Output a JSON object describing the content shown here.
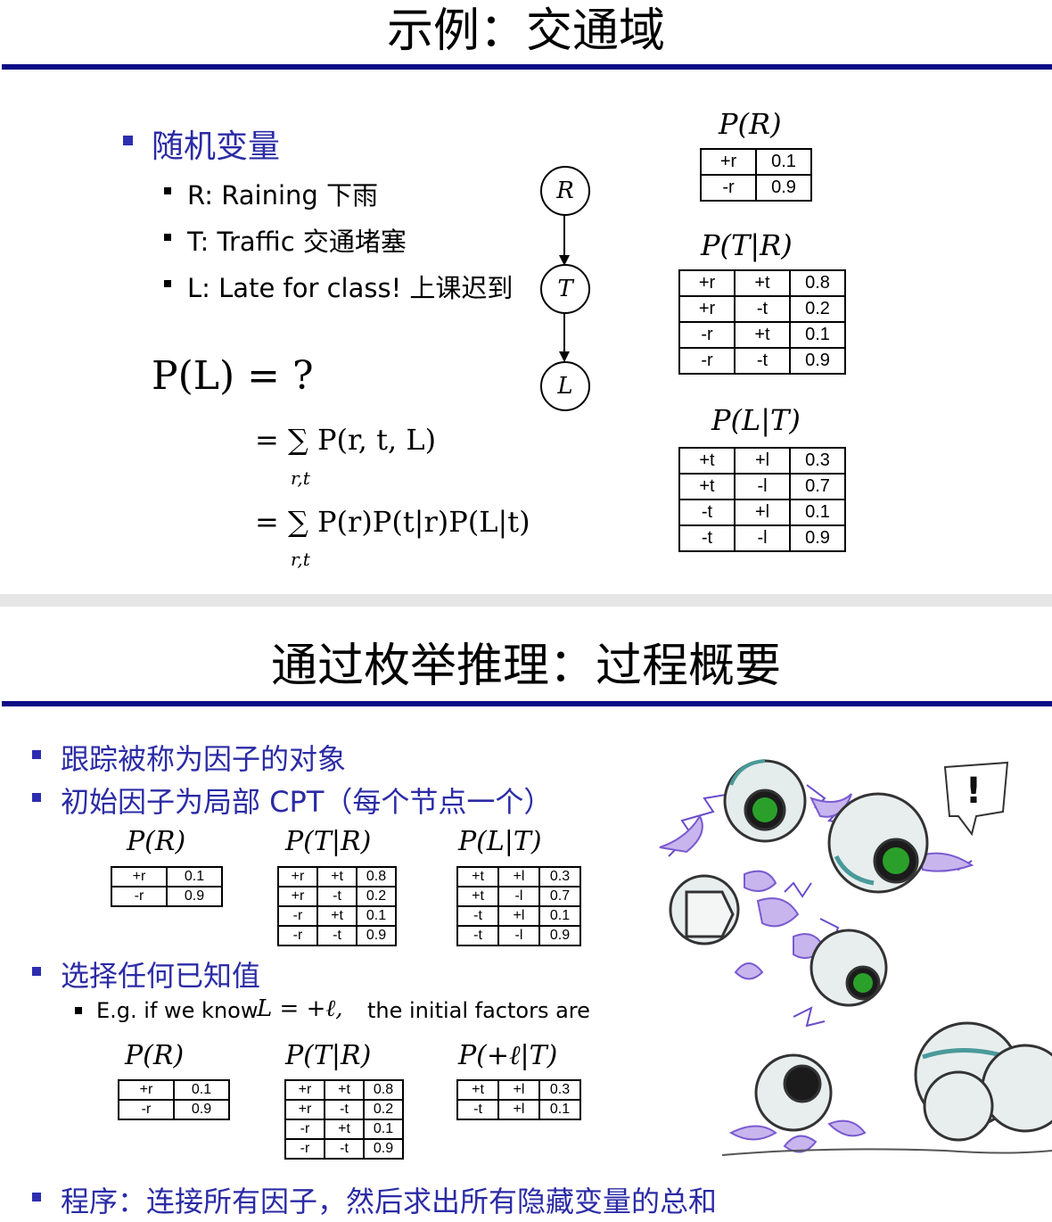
{
  "slide1": {
    "title": "示例：交通域",
    "heading": "随机变量",
    "items": [
      "R: Raining 下雨",
      "T: Traffic 交通堵塞",
      "L: Late for class! 上课迟到"
    ],
    "query": "P(L) = ?",
    "eq1": "= ∑ P(r, t, L)",
    "eq1_sub": "r,t",
    "eq2": "= ∑ P(r)P(t|r)P(L|t)",
    "eq2_sub": "r,t",
    "nodes": [
      "R",
      "T",
      "L"
    ],
    "cpt_r": {
      "title": "P(R)",
      "rows": [
        [
          "+r",
          "0.1"
        ],
        [
          "-r",
          "0.9"
        ]
      ]
    },
    "cpt_tr": {
      "title": "P(T|R)",
      "rows": [
        [
          "+r",
          "+t",
          "0.8"
        ],
        [
          "+r",
          "-t",
          "0.2"
        ],
        [
          "-r",
          "+t",
          "0.1"
        ],
        [
          "-r",
          "-t",
          "0.9"
        ]
      ]
    },
    "cpt_lt": {
      "title": "P(L|T)",
      "rows": [
        [
          "+t",
          "+l",
          "0.3"
        ],
        [
          "+t",
          "-l",
          "0.7"
        ],
        [
          "-t",
          "+l",
          "0.1"
        ],
        [
          "-t",
          "-l",
          "0.9"
        ]
      ]
    }
  },
  "slide2": {
    "title": "通过枚举推理：过程概要",
    "bullets": [
      "跟踪被称为因子的对象",
      "初始因子为局部 CPT（每个节点一个）",
      "选择任何已知值",
      "程序：连接所有因子，然后求出所有隐藏变量的总和"
    ],
    "eg_prefix": "E.g. if we know",
    "eg_math": "L = +ℓ,",
    "eg_suffix": "the initial factors are",
    "init_r": {
      "title": "P(R)",
      "rows": [
        [
          "+r",
          "0.1"
        ],
        [
          "-r",
          "0.9"
        ]
      ]
    },
    "init_tr": {
      "title": "P(T|R)",
      "rows": [
        [
          "+r",
          "+t",
          "0.8"
        ],
        [
          "+r",
          "-t",
          "0.2"
        ],
        [
          "-r",
          "+t",
          "0.1"
        ],
        [
          "-r",
          "-t",
          "0.9"
        ]
      ]
    },
    "init_lt": {
      "title": "P(L|T)",
      "rows": [
        [
          "+t",
          "+l",
          "0.3"
        ],
        [
          "+t",
          "-l",
          "0.7"
        ],
        [
          "-t",
          "+l",
          "0.1"
        ],
        [
          "-t",
          "-l",
          "0.9"
        ]
      ]
    },
    "sel_r": {
      "title": "P(R)",
      "rows": [
        [
          "+r",
          "0.1"
        ],
        [
          "-r",
          "0.9"
        ]
      ]
    },
    "sel_tr": {
      "title": "P(T|R)",
      "rows": [
        [
          "+r",
          "+t",
          "0.8"
        ],
        [
          "+r",
          "-t",
          "0.2"
        ],
        [
          "-r",
          "+t",
          "0.1"
        ],
        [
          "-r",
          "-t",
          "0.9"
        ]
      ]
    },
    "sel_lt": {
      "title": "P(+ℓ|T)",
      "rows": [
        [
          "+t",
          "+l",
          "0.3"
        ],
        [
          "-t",
          "+l",
          "0.1"
        ]
      ]
    },
    "exclaim": "!"
  },
  "colors": {
    "accent_blue": "#2b2ba6",
    "rule_blue": "#0c0c86",
    "robot_green": "#1e9a1e",
    "spark_purple": "#b49ce8"
  }
}
